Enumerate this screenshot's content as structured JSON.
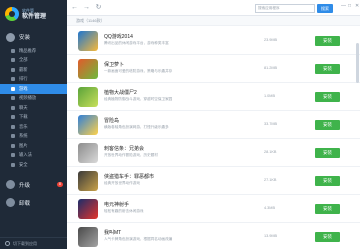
{
  "app": {
    "logo_small": "软件管",
    "logo_main": "软件管理"
  },
  "sidebar": {
    "sections": [
      {
        "label": "安装"
      }
    ],
    "items": [
      {
        "label": "精品推荐"
      },
      {
        "label": "全部"
      },
      {
        "label": "最新"
      },
      {
        "label": "排行"
      },
      {
        "label": "游戏"
      },
      {
        "label": "视频播放"
      },
      {
        "label": "聊天"
      },
      {
        "label": "下载"
      },
      {
        "label": "音乐"
      },
      {
        "label": "系统"
      },
      {
        "label": "图片"
      },
      {
        "label": "输入法"
      },
      {
        "label": "安全"
      }
    ],
    "upgrade": {
      "label": "升级",
      "badge": "8"
    },
    "uninstall": {
      "label": "卸载"
    },
    "bottom": {
      "label": "切下载到应用"
    }
  },
  "topbar": {
    "back": "←",
    "forward": "→",
    "refresh": "↻",
    "search_placeholder": "搜索应用程序",
    "search_button": "搜索",
    "controls": [
      "—",
      "□",
      "✕"
    ]
  },
  "content": {
    "section_title": "游戏（1146款）",
    "install_label": "安装",
    "apps": [
      {
        "name": "QQ游戏2014",
        "desc": "腾讯出品的休闲游戏平台，游戏种类丰富",
        "size": "23.9MB",
        "icon_colors": [
          "#1e76d0",
          "#f7b93a"
        ]
      },
      {
        "name": "保卫萝卜",
        "desc": "一款画面可爱的塔防游戏，策略与乐趣并存",
        "size": "81.2MB",
        "icon_colors": [
          "#e35a2b",
          "#6cbb3c"
        ]
      },
      {
        "name": "植物大战僵尸2",
        "desc": "经典植物防御战斗游戏，穿越时空保卫家园",
        "size": "1.0MB",
        "icon_colors": [
          "#5aa33a",
          "#c8e05a"
        ]
      },
      {
        "name": "冒险岛",
        "desc": "横版卷轴角色扮演网游，打怪升级乐趣多",
        "size": "33.7MB",
        "icon_colors": [
          "#2f7fd8",
          "#ffd24a"
        ]
      },
      {
        "name": "刺客信条：兄弟会",
        "desc": "开放世界动作冒险游戏，历史题材",
        "size": "28.1KB",
        "icon_colors": [
          "#8c8c8c",
          "#d9d9d9"
        ]
      },
      {
        "name": "侠盗猎车手：罪恶都市",
        "desc": "经典开放世界动作游戏",
        "size": "27.1KB",
        "icon_colors": [
          "#3a3a3a",
          "#c9a24a"
        ]
      },
      {
        "name": "电元神射手",
        "desc": "轻松有趣的射击休闲游戏",
        "size": "4.3MB",
        "icon_colors": [
          "#1b2d6b",
          "#e4342a"
        ]
      },
      {
        "name": "我叫MT",
        "desc": "人气卡牌角色扮演游戏，根据同名动画改编",
        "size": "13.9MB",
        "icon_colors": [
          "#4a4a4a",
          "#a3a3a3"
        ]
      }
    ]
  }
}
